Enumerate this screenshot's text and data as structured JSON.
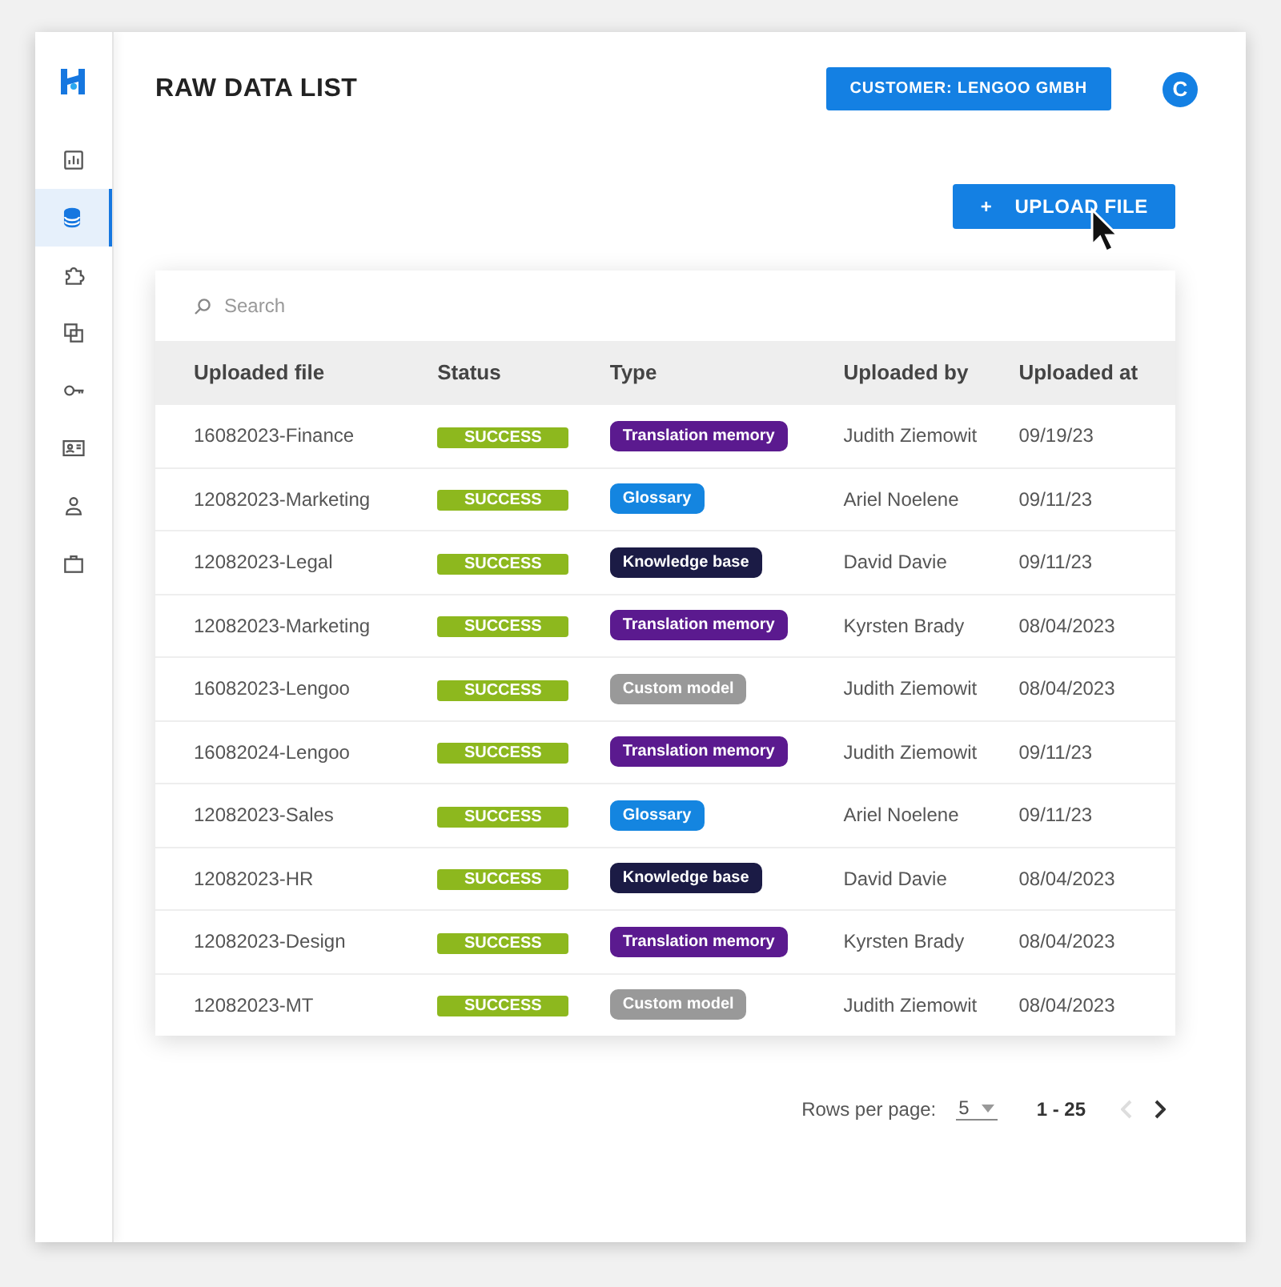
{
  "sidebar": {
    "items": [
      {
        "kind": "chart",
        "selected": false
      },
      {
        "kind": "database",
        "selected": true
      },
      {
        "kind": "puzzle",
        "selected": false
      },
      {
        "kind": "copy",
        "selected": false
      },
      {
        "kind": "key",
        "selected": false
      },
      {
        "kind": "card",
        "selected": false
      },
      {
        "kind": "user",
        "selected": false
      },
      {
        "kind": "briefcase",
        "selected": false
      }
    ]
  },
  "header": {
    "title": "RAW DATA LIST",
    "customer_button": "CUSTOMER: LENGOO GMBH",
    "avatar": "C"
  },
  "upload_button": {
    "icon": "+",
    "label": "UPLOAD FILE"
  },
  "search": {
    "placeholder": "Search"
  },
  "table": {
    "columns": [
      "Uploaded file",
      "Status",
      "Type",
      "Uploaded by",
      "Uploaded at"
    ],
    "rows": [
      {
        "file": "16082023-Finance",
        "status": "SUCCESS",
        "type": "Translation memory",
        "color": "#5b1a8f",
        "by": "Judith Ziemowit",
        "at": "09/19/23"
      },
      {
        "file": "12082023-Marketing",
        "status": "SUCCESS",
        "type": "Glossary",
        "color": "#1485e0",
        "by": "Ariel Noelene",
        "at": "09/11/23"
      },
      {
        "file": "12082023-Legal",
        "status": "SUCCESS",
        "type": "Knowledge base",
        "color": "#1b1b45",
        "by": "David Davie",
        "at": "09/11/23"
      },
      {
        "file": "12082023-Marketing",
        "status": "SUCCESS",
        "type": "Translation memory",
        "color": "#5b1a8f",
        "by": "Kyrsten Brady",
        "at": "08/04/2023"
      },
      {
        "file": "16082023-Lengoo",
        "status": "SUCCESS",
        "type": "Custom model",
        "color": "#999999",
        "by": "Judith Ziemowit",
        "at": "08/04/2023"
      },
      {
        "file": "16082024-Lengoo",
        "status": "SUCCESS",
        "type": "Translation memory",
        "color": "#5b1a8f",
        "by": "Judith Ziemowit",
        "at": "09/11/23"
      },
      {
        "file": "12082023-Sales",
        "status": "SUCCESS",
        "type": "Glossary",
        "color": "#1485e0",
        "by": "Ariel Noelene",
        "at": "09/11/23"
      },
      {
        "file": "12082023-HR",
        "status": "SUCCESS",
        "type": "Knowledge base",
        "color": "#1b1b45",
        "by": "David Davie",
        "at": "08/04/2023"
      },
      {
        "file": "12082023-Design",
        "status": "SUCCESS",
        "type": "Translation memory",
        "color": "#5b1a8f",
        "by": "Kyrsten Brady",
        "at": "08/04/2023"
      },
      {
        "file": "12082023-MT",
        "status": "SUCCESS",
        "type": "Custom model",
        "color": "#999999",
        "by": "Judith Ziemowit",
        "at": "08/04/2023"
      }
    ]
  },
  "pagination": {
    "label": "Rows per page:",
    "rows_per_page": "5",
    "range": "1 - 25",
    "prev_disabled": true,
    "next_disabled": false
  }
}
